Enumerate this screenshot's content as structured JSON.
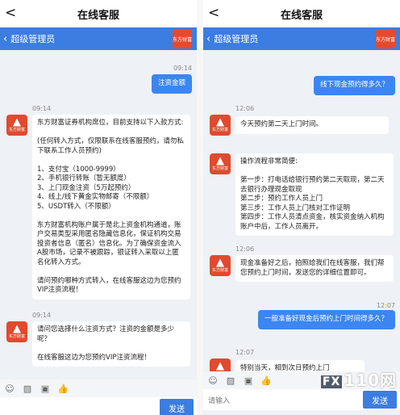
{
  "left": {
    "title": "在线客服",
    "agent_name": "超级管理员",
    "logo_text": "东方财富",
    "messages": [
      {
        "time": "09:14",
        "user_text": "注资金额"
      },
      {
        "time": "09:14",
        "agent_text": "东方财富证券机构席位，目前支持以下入款方式:\n\n(任何转入方式，仅限联系在线客服预约，请勿私下联系工作人员预约)\n\n1、支付宝（1000-9999）\n2、手机银行转账（暂无额度）\n3、上门现金注资（5万起预约）\n4、线上/线下黄金实物邮寄（不限额）\n5、USDT转入（不限额）\n\n东方财富机构账户属于是北上资金机构通道，账户交易类型采用匿名隐藏信息化，保证机构交易投资者信息（匿名）信息化。为了确保资金流入A股市场，记录不被跟踪，银证转入采取以上匿名化转入方式。\n\n请问预约哪种方式转入，在线客服这边为您预约VIP注资流程！"
      },
      {
        "time": "09:14",
        "agent_text": "请问您选择什么注资方式？注资的金额是多少呢？\n\n在线客服这边为您预约VIP注资流程！"
      }
    ],
    "input_placeholder": "",
    "send_label": "发送"
  },
  "right": {
    "title": "在线客服",
    "agent_name": "超级管理员",
    "logo_text": "东方财富",
    "messages": [
      {
        "user_text": "线下现金预约得多久？"
      },
      {
        "time": "12:06",
        "agent_text": "今天预约第二天上门时间。"
      },
      {
        "agent_text": "操作流程非常简便:\n\n第一步：打电话给银行预约第二天取现，第二天去银行办理现金取现\n第二步：预约工作人员上门\n第三步：工作人员上门核对工作证明\n第四步：工作人员清点资金，核实资金纳入机构账户中后，工作人员离开。"
      },
      {
        "time": "12:06",
        "agent_text": "现金准备好之后，拍照给我们在线客服，我们帮您预约上门时间，发送您的详细位置即可。"
      },
      {
        "time": "12:07",
        "user_text": "一般准备好现金后预约上门时间得多久？"
      },
      {
        "time": "12:07",
        "agent_text": "特别当天，相到次日预约上门"
      }
    ],
    "input_placeholder": "请输入",
    "send_label": "发送"
  },
  "watermark": {
    "box": "FX",
    "text": "110网"
  },
  "colors": {
    "accent": "#3b7de0",
    "user_bubble": "#3b86f0",
    "logo": "#e04a2e"
  },
  "icons": {
    "back": "chevron-left-icon",
    "emoji": "smiley-icon",
    "image": "image-icon",
    "thumb": "thumbs-up-icon"
  }
}
